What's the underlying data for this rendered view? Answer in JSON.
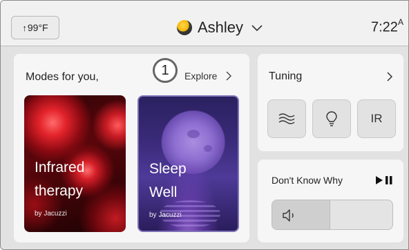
{
  "header": {
    "temperature": "99°F",
    "temperature_arrow": "↑",
    "user_name": "Ashley",
    "time": "7:22",
    "time_suffix": "A"
  },
  "modes": {
    "title": "Modes for you,",
    "badge": "1",
    "explore_label": "Explore",
    "cards": [
      {
        "title_line1": "Infrared",
        "title_line2": "therapy",
        "by": "by Jacuzzi"
      },
      {
        "title_line1": "Sleep",
        "title_line2": "Well",
        "by": "by Jacuzzi"
      }
    ]
  },
  "tuning": {
    "title": "Tuning",
    "buttons": [
      {
        "icon": "waves-icon"
      },
      {
        "icon": "lightbulb-icon"
      },
      {
        "label": "IR"
      }
    ]
  },
  "music": {
    "song": "Don't Know Why",
    "volume_level": 0.48
  },
  "colors": {
    "background": "#e2e2e2",
    "panel": "#f6f6f6",
    "text": "#222222"
  }
}
